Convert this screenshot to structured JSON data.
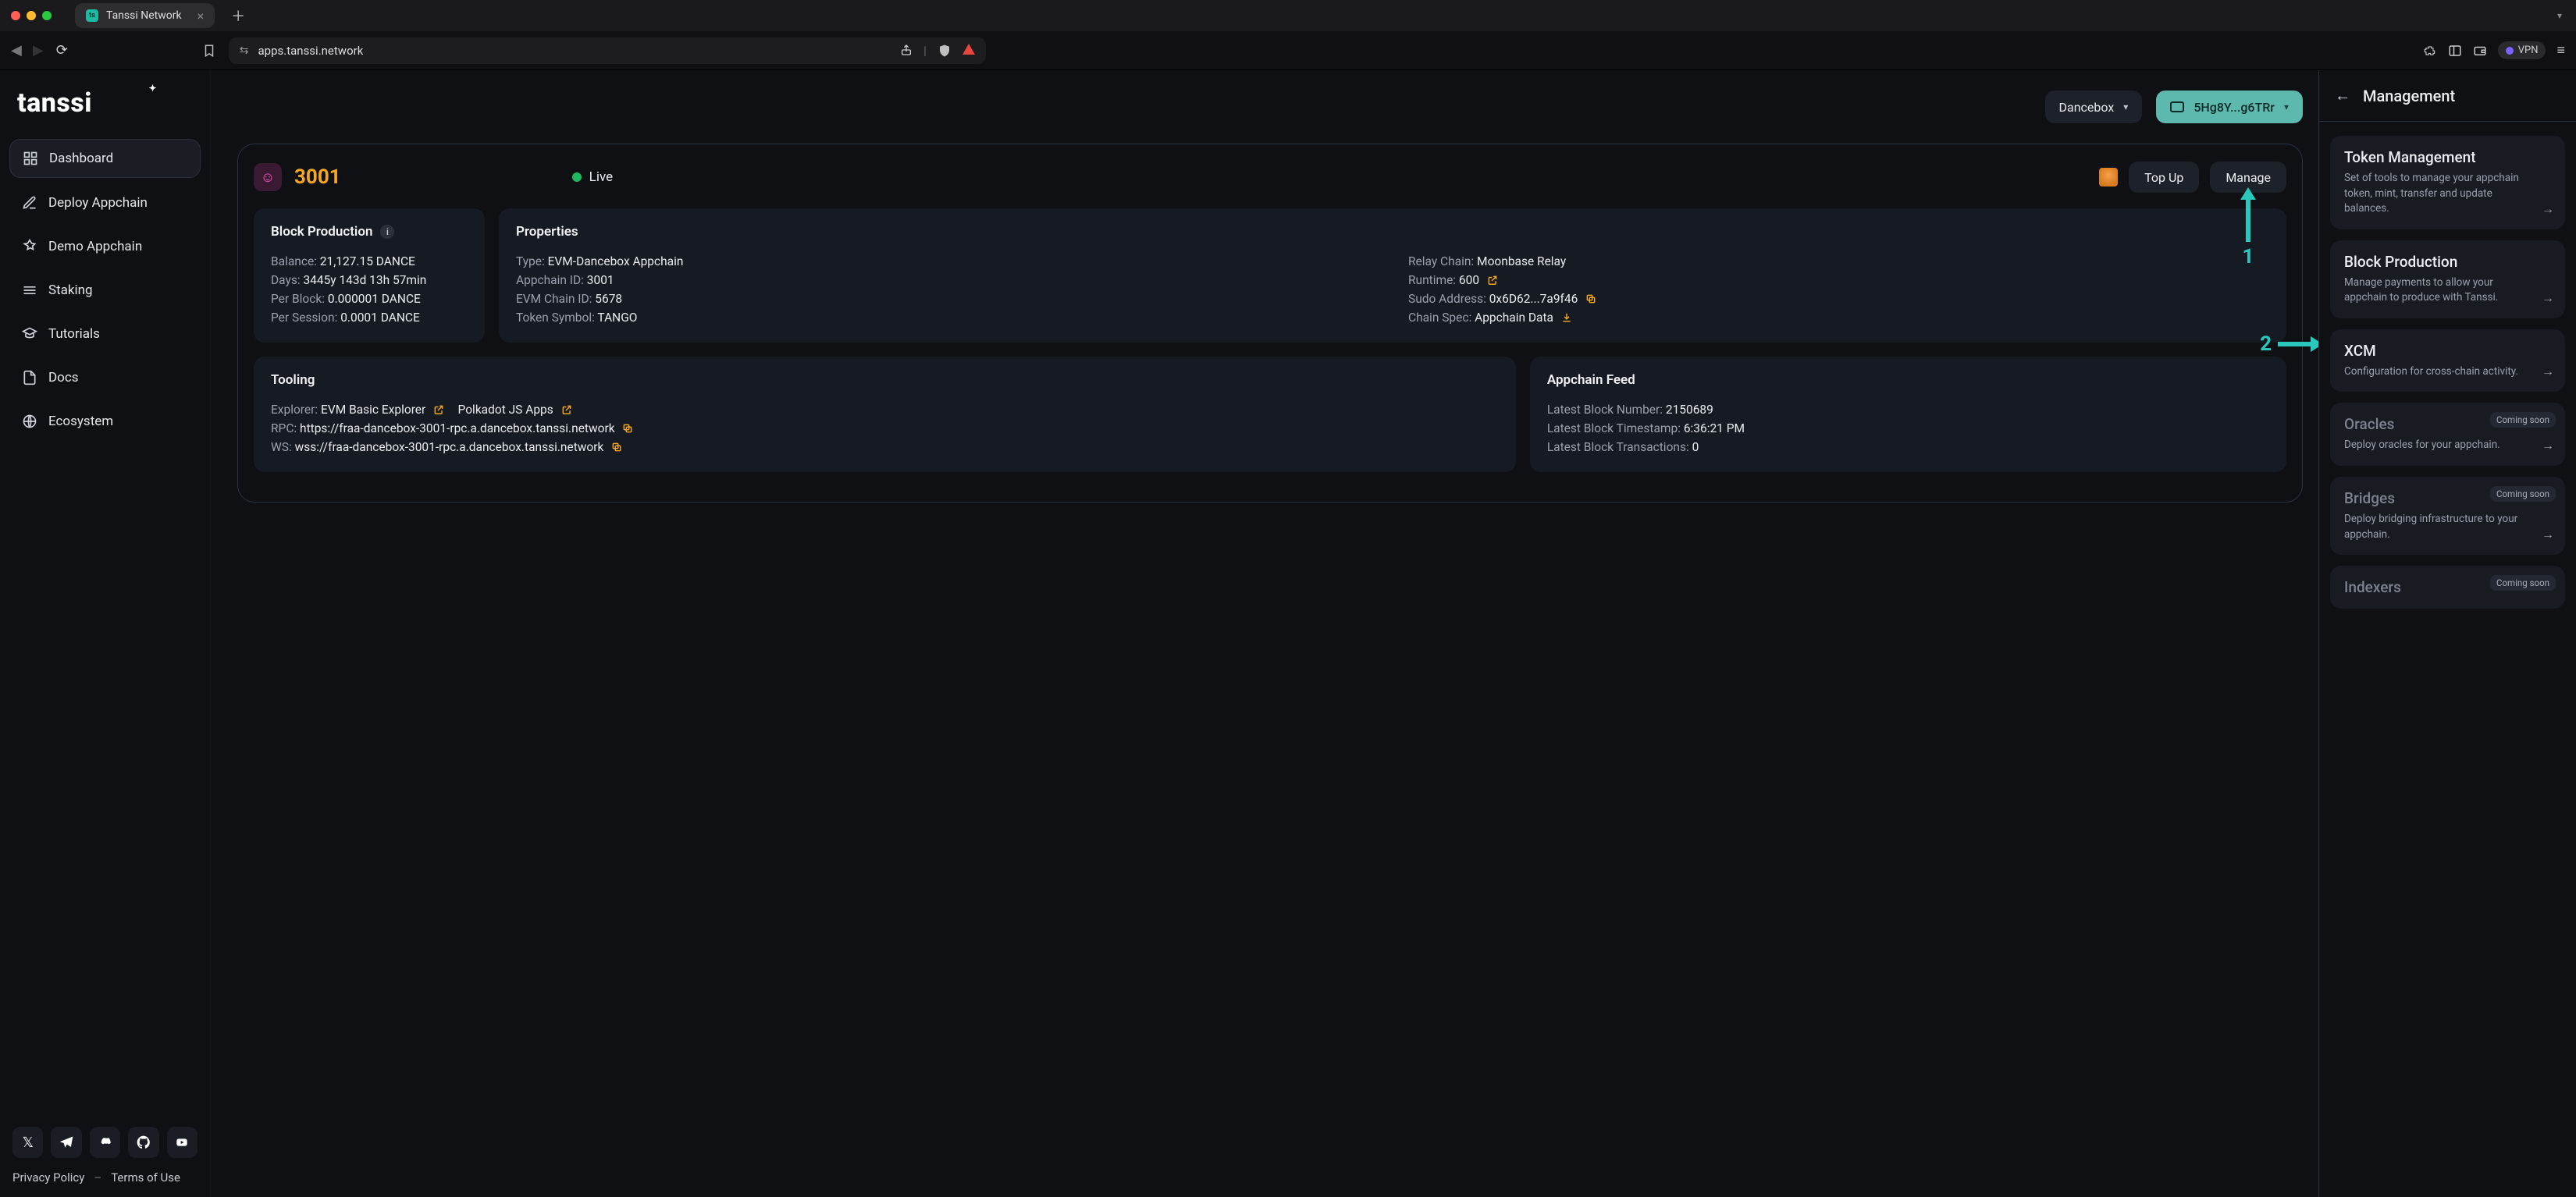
{
  "browser": {
    "tab_title": "Tanssi Network",
    "url": "apps.tanssi.network",
    "vpn_label": "VPN"
  },
  "brand": {
    "logo_text": "tanssi"
  },
  "sidebar": {
    "items": [
      {
        "label": "Dashboard"
      },
      {
        "label": "Deploy Appchain"
      },
      {
        "label": "Demo Appchain"
      },
      {
        "label": "Staking"
      },
      {
        "label": "Tutorials"
      },
      {
        "label": "Docs"
      },
      {
        "label": "Ecosystem"
      }
    ],
    "privacy": "Privacy Policy",
    "terms": "Terms of Use"
  },
  "header": {
    "network_label": "Dancebox",
    "wallet_label": "5Hg8Y...g6TRr"
  },
  "panel": {
    "chain_id": "3001",
    "status": "Live",
    "topup_label": "Top Up",
    "manage_label": "Manage"
  },
  "block_production": {
    "title": "Block Production",
    "balance_k": "Balance:",
    "balance_v": "21,127.15 DANCE",
    "days_k": "Days:",
    "days_v": "3445y 143d 13h 57min",
    "per_block_k": "Per Block:",
    "per_block_v": "0.000001 DANCE",
    "per_session_k": "Per Session:",
    "per_session_v": "0.0001 DANCE"
  },
  "properties": {
    "title": "Properties",
    "type_k": "Type:",
    "type_v": "EVM-Dancebox Appchain",
    "appchain_id_k": "Appchain ID:",
    "appchain_id_v": "3001",
    "evm_chain_k": "EVM Chain ID:",
    "evm_chain_v": "5678",
    "symbol_k": "Token Symbol:",
    "symbol_v": "TANGO",
    "relay_k": "Relay Chain:",
    "relay_v": "Moonbase Relay",
    "runtime_k": "Runtime:",
    "runtime_v": "600",
    "sudo_k": "Sudo Address:",
    "sudo_v": "0x6D62...7a9f46",
    "spec_k": "Chain Spec:",
    "spec_v": "Appchain Data"
  },
  "tooling": {
    "title": "Tooling",
    "explorer_k": "Explorer:",
    "explorer_v1": "EVM Basic Explorer",
    "explorer_v2": "Polkadot JS Apps",
    "rpc_k": "RPC:",
    "rpc_v": "https://fraa-dancebox-3001-rpc.a.dancebox.tanssi.network",
    "ws_k": "WS:",
    "ws_v": "wss://fraa-dancebox-3001-rpc.a.dancebox.tanssi.network"
  },
  "feed": {
    "title": "Appchain Feed",
    "lbn_k": "Latest Block Number:",
    "lbn_v": "2150689",
    "lbt_k": "Latest Block Timestamp:",
    "lbt_v": "6:36:21 PM",
    "lbx_k": "Latest Block Transactions:",
    "lbx_v": "0"
  },
  "mgmt": {
    "title": "Management",
    "coming_soon": "Coming soon",
    "cards": [
      {
        "title": "Token Management",
        "desc": "Set of tools to manage your appchain token, mint, transfer and update balances."
      },
      {
        "title": "Block Production",
        "desc": "Manage payments to allow your appchain to produce with Tanssi."
      },
      {
        "title": "XCM",
        "desc": "Configuration for cross-chain activity."
      },
      {
        "title": "Oracles",
        "desc": "Deploy oracles for your appchain."
      },
      {
        "title": "Bridges",
        "desc": "Deploy bridging infrastructure to your appchain."
      },
      {
        "title": "Indexers",
        "desc": ""
      }
    ]
  },
  "annotations": {
    "one": "1",
    "two": "2"
  }
}
